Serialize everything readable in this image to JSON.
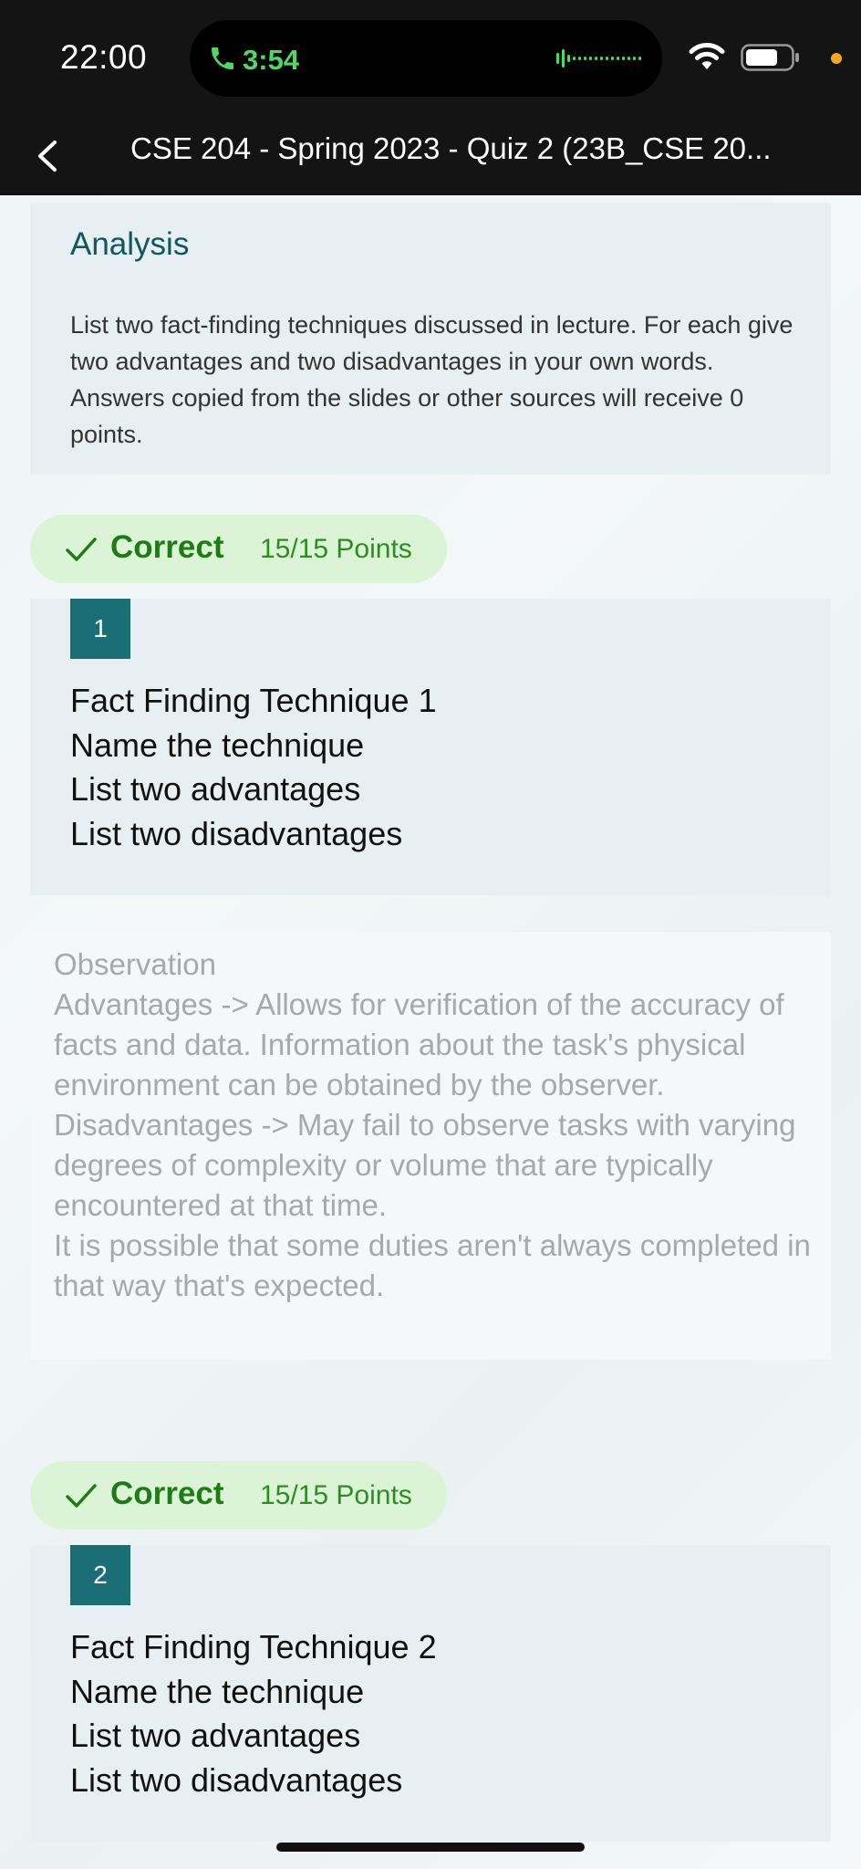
{
  "status": {
    "time": "22:00",
    "call_time": "3:54",
    "icons": [
      "phone-icon",
      "audio-wave-icon",
      "wifi-icon",
      "battery-icon",
      "orange-indicator-dot"
    ]
  },
  "nav": {
    "title": "CSE 204 - Spring 2023 - Quiz 2 (23B_CSE 20..."
  },
  "analysis": {
    "heading": "Analysis",
    "body": "List two fact-finding techniques discussed in lecture. For each give two advantages and two disadvantages in your own words. Answers copied from the slides or other sources will receive 0 points."
  },
  "questions": [
    {
      "result": "Correct",
      "points": "15/15 Points",
      "number": "1",
      "lines": [
        "Fact Finding Technique 1",
        "Name the technique",
        "List two advantages",
        "List two disadvantages"
      ],
      "answer": "Observation\nAdvantages -> Allows for verification of the accuracy of facts and data. Information about the task's physical environment can be obtained by the observer.\nDisadvantages -> May fail to observe tasks with varying degrees of complexity or volume that are typically encountered at that time.\nIt is possible that some duties aren't always completed in that way that's expected."
    },
    {
      "result": "Correct",
      "points": "15/15 Points",
      "number": "2",
      "lines": [
        "Fact Finding Technique 2",
        "Name the technique",
        "List two advantages",
        "List two disadvantages"
      ]
    }
  ],
  "colors": {
    "accent_teal": "#1a6e75",
    "correct_green": "#1e7b16",
    "badge_bg": "#dcf4d6",
    "card_bg": "#e7eff2"
  }
}
